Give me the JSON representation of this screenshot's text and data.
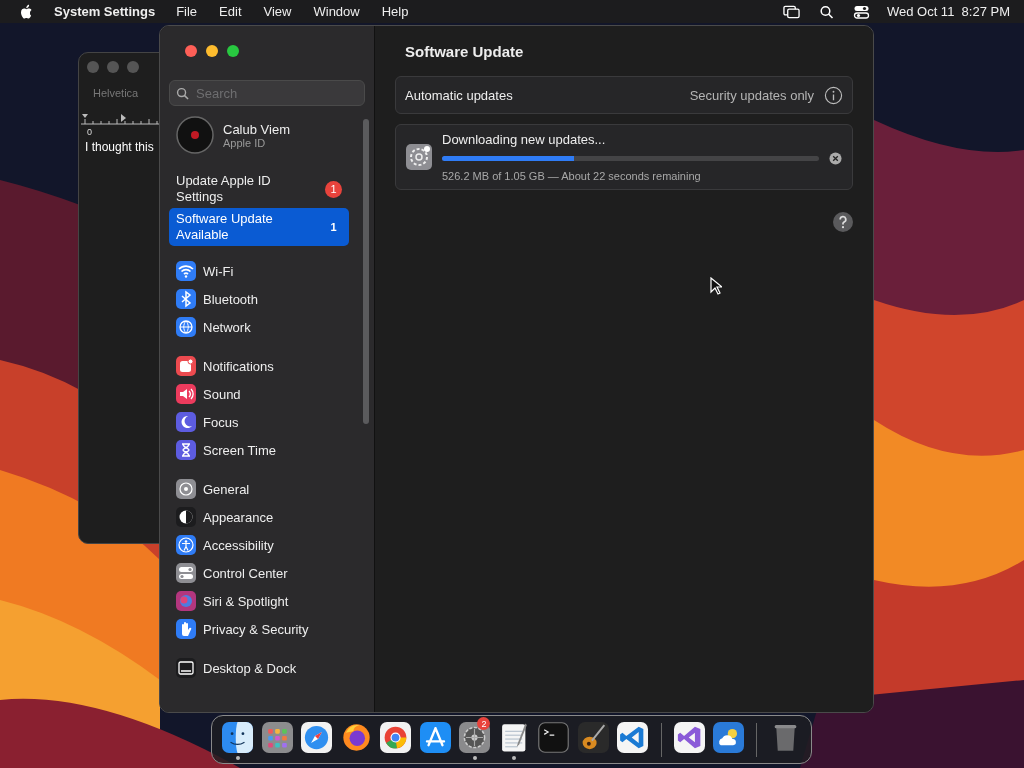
{
  "menu_bar": {
    "app": "System Settings",
    "menus": [
      "File",
      "Edit",
      "View",
      "Window",
      "Help"
    ],
    "clock": "Wed Oct 11  8:27 PM"
  },
  "background_window": {
    "font": "Helvetica",
    "ruler_mark": "0",
    "text": "I thought this"
  },
  "sidebar": {
    "search": {
      "placeholder": "Search"
    },
    "account": {
      "name": "Calub Viem",
      "subtitle": "Apple ID"
    },
    "notices": [
      {
        "label": "Update Apple ID Settings",
        "badge": "1",
        "selected": false
      },
      {
        "label": "Software Update Available",
        "badge": "1",
        "selected": true
      }
    ],
    "groups": [
      [
        {
          "label": "Wi-Fi",
          "kind": "wifi",
          "color": "#2f7cf6"
        },
        {
          "label": "Bluetooth",
          "kind": "bluetooth",
          "color": "#2f7cf6"
        },
        {
          "label": "Network",
          "kind": "globe",
          "color": "#2f7cf6"
        }
      ],
      [
        {
          "label": "Notifications",
          "kind": "bell",
          "color": "#ec4a4f"
        },
        {
          "label": "Sound",
          "kind": "speaker",
          "color": "#ec3b5d"
        },
        {
          "label": "Focus",
          "kind": "moon",
          "color": "#5d5ce0"
        },
        {
          "label": "Screen Time",
          "kind": "hourglass",
          "color": "#5d5ce0"
        }
      ],
      [
        {
          "label": "General",
          "kind": "gear",
          "color": "#8e8e93"
        },
        {
          "label": "Appearance",
          "kind": "contrast",
          "color": "#1c1c1e"
        },
        {
          "label": "Accessibility",
          "kind": "person",
          "color": "#2f7cf6"
        },
        {
          "label": "Control Center",
          "kind": "toggles",
          "color": "#8e8e93"
        },
        {
          "label": "Siri & Spotlight",
          "kind": "orb",
          "color": "#b3367e"
        },
        {
          "label": "Privacy & Security",
          "kind": "hand",
          "color": "#2f7cf6"
        }
      ],
      [
        {
          "label": "Desktop & Dock",
          "kind": "dock",
          "color": "#1c1c1e"
        }
      ]
    ]
  },
  "content": {
    "title": "Software Update",
    "automatic": {
      "label": "Automatic updates",
      "value": "Security updates only"
    },
    "download": {
      "title": "Downloading new updates...",
      "level": 0.35,
      "status": "526.2 MB of 1.05 GB — About 22 seconds remaining"
    }
  },
  "dock": {
    "items": [
      {
        "kind": "finder",
        "running": true
      },
      {
        "kind": "launchpad",
        "running": false
      },
      {
        "kind": "safari",
        "running": false
      },
      {
        "kind": "firefox",
        "running": false
      },
      {
        "kind": "chrome",
        "running": false
      },
      {
        "kind": "appstore",
        "running": false
      },
      {
        "kind": "settings",
        "running": true,
        "badge": "2"
      },
      {
        "kind": "textedit",
        "running": true
      },
      {
        "kind": "terminal",
        "running": false
      },
      {
        "kind": "guitar",
        "running": false
      },
      {
        "kind": "vscode",
        "running": false
      },
      {
        "kind": "separator"
      },
      {
        "kind": "visualstudio",
        "running": false
      },
      {
        "kind": "weather",
        "running": false
      },
      {
        "kind": "separator"
      },
      {
        "kind": "trash",
        "running": false
      }
    ]
  }
}
